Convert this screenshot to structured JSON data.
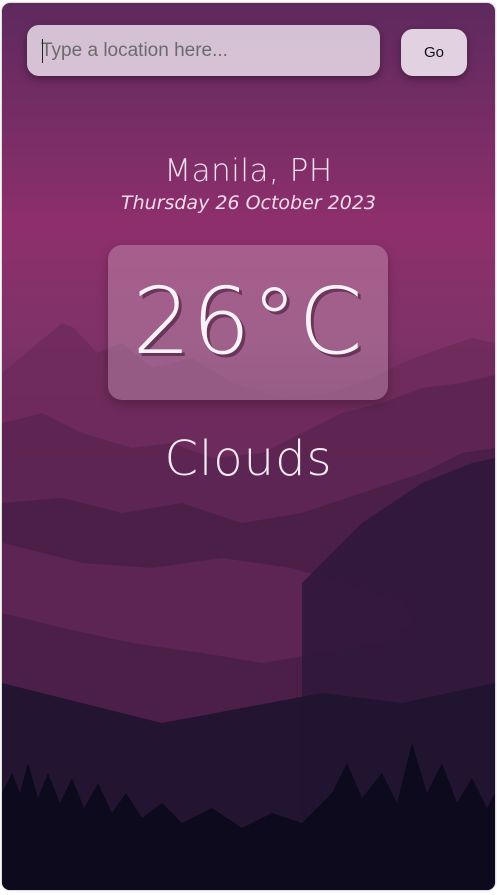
{
  "search": {
    "placeholder": "Type a location here...",
    "value": ""
  },
  "go_button": {
    "label": "Go"
  },
  "location": {
    "city": "Manila, PH",
    "date": "Thursday 26 October 2023"
  },
  "weather": {
    "temperature": "26°C",
    "condition": "Clouds"
  },
  "colors": {
    "background_top": "#5e2a5e",
    "background_mid": "#8e2f6c",
    "background_bottom": "#0c0a1c",
    "text": "#f7ebf3",
    "input_bg": "#e8dae8"
  }
}
